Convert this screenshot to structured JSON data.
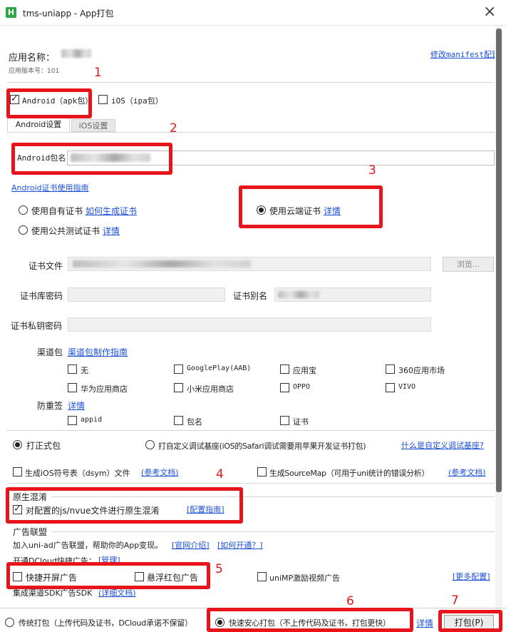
{
  "window": {
    "title": "tms-uniapp - App打包",
    "close": "×"
  },
  "app": {
    "name_label": "应用名称：",
    "version_label": "应用版本号：101",
    "modify_manifest_link": "修改manifest配置"
  },
  "platforms": {
    "android": {
      "label": "Android（apk包）",
      "checked": true
    },
    "ios": {
      "label": "iOS（ipa包）",
      "checked": false
    }
  },
  "tabs": [
    {
      "label": "Android设置",
      "active": true
    },
    {
      "label": "iOS设置",
      "active": false
    }
  ],
  "package": {
    "label": "Android包名"
  },
  "cert_guide_link": "Android证书使用指南",
  "cert_options": {
    "own": {
      "label": "使用自有证书",
      "link": "如何生成证书",
      "checked": false
    },
    "public": {
      "label": "使用公共测试证书",
      "link": "详情",
      "checked": false
    },
    "cloud": {
      "label": "使用云端证书",
      "link": "详情",
      "checked": true
    }
  },
  "cert_fields": {
    "file_label": "证书文件",
    "browse_button": "浏览...",
    "store_password_label": "证书库密码",
    "alias_label": "证书别名",
    "private_key_label": "证书私钥密码"
  },
  "channels": {
    "label": "渠道包",
    "guide_link": "渠道包制作指南",
    "items": [
      "无",
      "GooglePlay(AAB)",
      "应用宝",
      "360应用市场",
      "华为应用商店",
      "小米应用商店",
      "OPPO",
      "VIVO"
    ]
  },
  "anti_tamper": {
    "label": "防重签",
    "link": "详情",
    "items": [
      "appid",
      "包名",
      "证书"
    ]
  },
  "build_type": {
    "formal": {
      "label": "打正式包",
      "checked": true
    },
    "custom": {
      "label": "打自定义调试基座(iOS的Safari调试需要用苹果开发证书打包)",
      "checked": false
    },
    "custom_link": "什么是自定义调试基座?"
  },
  "symbols": {
    "dsym": {
      "label": "生成iOS符号表（dsym）文件",
      "link": "(参考文档)"
    },
    "sourcemap": {
      "label": "生成SourceMap（可用于uni统计的错误分析）",
      "link": "(参考文档)"
    }
  },
  "obfuscation": {
    "title": "原生混淆",
    "checkbox_label": "对配置的js/nvue文件进行原生混淆",
    "checked": true,
    "link": "[配置指南]"
  },
  "ads": {
    "title": "广告联盟",
    "desc": "加入uni-ad广告联盟，帮助你的App变现。",
    "link_intro": "[官网介绍]",
    "link_how": "[如何开通？]",
    "dcloud_label": "开通DCloud快捷广告：",
    "manage_link": "[管理]",
    "splash": "快捷开屏广告",
    "float_redpack": "悬浮红包广告",
    "video": "uniMP激励视频广告",
    "more_link": "[更多配置]",
    "sdk_label": "集成渠道SDK广告SDK",
    "sdk_link": "(详细文档)"
  },
  "footer": {
    "traditional": {
      "label": "传统打包（上传代码及证书，DCloud承诺不保留）",
      "checked": false
    },
    "fast_safe": {
      "label": "快速安心打包（不上传代码及证书，打包更快）",
      "checked": true
    },
    "detail_link": "详情",
    "build_button": "打包(P)"
  },
  "annotations": [
    "1",
    "2",
    "3",
    "4",
    "5",
    "6",
    "7"
  ],
  "colors": {
    "annotation_red": "#e8141b",
    "link_blue": "#1a4fd8",
    "logo_green": "#2aa642"
  }
}
